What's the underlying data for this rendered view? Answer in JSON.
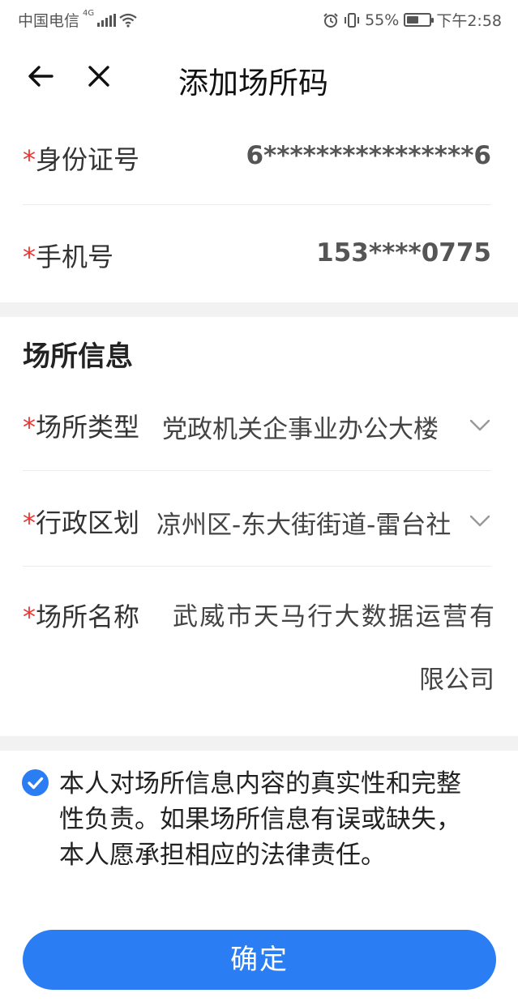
{
  "status_bar": {
    "carrier": "中国电信",
    "network_type": "4G",
    "battery_percent": "55%",
    "battery_level": 0.55,
    "time": "下午2:58"
  },
  "nav": {
    "back_icon": "arrow-left-icon",
    "close_icon": "close-icon",
    "title": "添加场所码"
  },
  "form": {
    "required_mark": "*",
    "id_number": {
      "label": "身份证号",
      "value": "6****************6"
    },
    "phone": {
      "label": "手机号",
      "value": "153****0775"
    }
  },
  "place_info": {
    "section_title": "场所信息",
    "place_type": {
      "label": "场所类型",
      "value": "党政机关企事业办公大楼"
    },
    "district": {
      "label": "行政区划",
      "value": "凉州区-东大街街道-雷台社"
    },
    "place_name": {
      "label": "场所名称",
      "value": "武威市天马行大数据运营有限公司"
    }
  },
  "agreement": {
    "checked": true,
    "text": "本人对场所信息内容的真实性和完整性负责。如果场所信息有误或缺失，本人愿承担相应的法律责任。"
  },
  "confirm_button": {
    "label": "确定"
  },
  "colors": {
    "accent": "#2a7df2",
    "required": "#e53935",
    "section_gap": "#f2f2f2"
  }
}
